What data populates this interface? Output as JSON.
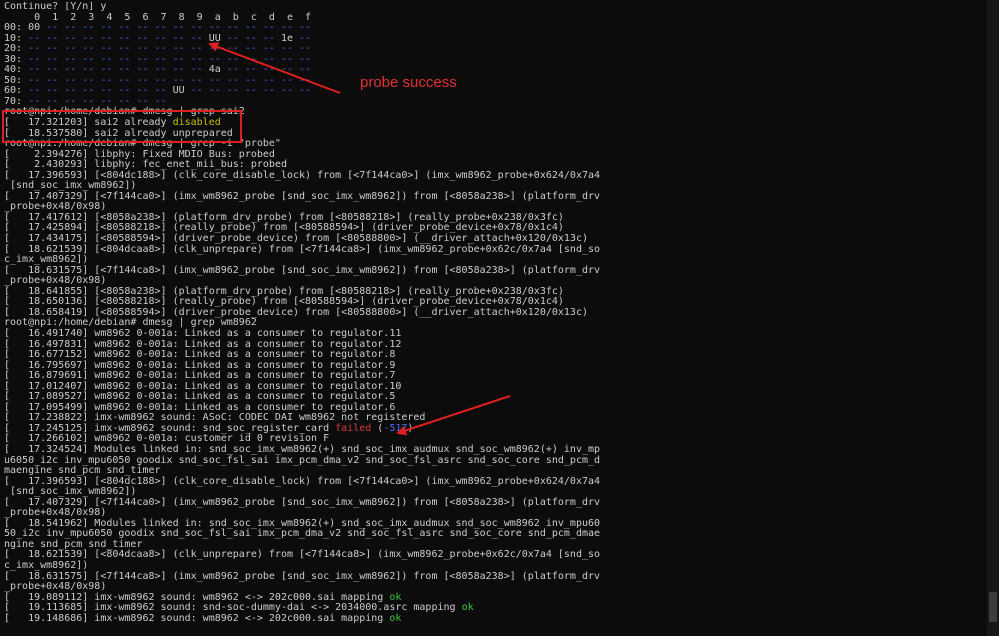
{
  "terminal": {
    "lines": [
      [
        {
          "t": "Continue? [Y/n] y",
          "c": "grey"
        }
      ],
      [
        {
          "t": "     0  1  2  3  4  5  6  7  8  9  a  b  c  d  e  f",
          "c": "grey"
        }
      ],
      [
        {
          "t": "00: 00 ",
          "c": "grey"
        },
        {
          "t": "-- -- -- -- -- -- -- -- -- -- -- -- -- -- --",
          "c": "blue"
        }
      ],
      [
        {
          "t": "10: ",
          "c": "grey"
        },
        {
          "t": "-- -- -- -- -- -- -- -- -- -- ",
          "c": "blue"
        },
        {
          "t": "UU",
          "c": "grey"
        },
        {
          "t": " -- -- -- ",
          "c": "blue"
        },
        {
          "t": "1e",
          "c": "grey"
        },
        {
          "t": " --",
          "c": "blue"
        }
      ],
      [
        {
          "t": "20: ",
          "c": "grey"
        },
        {
          "t": "-- -- -- -- -- -- -- -- -- -- -- -- -- -- -- --",
          "c": "blue"
        }
      ],
      [
        {
          "t": "30: ",
          "c": "grey"
        },
        {
          "t": "-- -- -- -- -- -- -- -- -- -- -- -- -- -- -- --",
          "c": "blue"
        }
      ],
      [
        {
          "t": "40: ",
          "c": "grey"
        },
        {
          "t": "-- -- -- -- -- -- -- -- -- -- ",
          "c": "blue"
        },
        {
          "t": "4a",
          "c": "grey"
        },
        {
          "t": " -- -- -- -- --",
          "c": "blue"
        }
      ],
      [
        {
          "t": "50: ",
          "c": "grey"
        },
        {
          "t": "-- -- -- -- -- -- -- -- -- -- -- -- -- -- -- --",
          "c": "blue"
        }
      ],
      [
        {
          "t": "60: ",
          "c": "grey"
        },
        {
          "t": "-- -- -- -- -- -- -- -- ",
          "c": "blue"
        },
        {
          "t": "UU",
          "c": "grey"
        },
        {
          "t": " -- -- -- -- -- -- --",
          "c": "blue"
        }
      ],
      [
        {
          "t": "70: ",
          "c": "grey"
        },
        {
          "t": "-- -- -- -- -- -- -- --",
          "c": "blue"
        }
      ],
      [
        {
          "t": "root@npi:/home/debian# dmesg | grep sai2",
          "c": "grey"
        }
      ],
      [
        {
          "t": "[   17.321203] sai2 already ",
          "c": "grey"
        },
        {
          "t": "disabled",
          "c": "yellow"
        }
      ],
      [
        {
          "t": "[   18.537580] sai2 already unprepared",
          "c": "grey"
        }
      ],
      [
        {
          "t": "root@npi:/home/debian# dmesg | grep -i \"probe\"",
          "c": "grey"
        }
      ],
      [
        {
          "t": "[    2.394276] libphy: Fixed MDIO Bus: probed",
          "c": "grey"
        }
      ],
      [
        {
          "t": "[    2.430293] libphy: fec_enet_mii_bus: probed",
          "c": "grey"
        }
      ],
      [
        {
          "t": "[   17.396593] [<804dc188>] (clk_core_disable_lock) from [<7f144ca0>] (imx_wm8962_probe+0x624/0x7a4",
          "c": "grey"
        }
      ],
      [
        {
          "t": " [snd_soc_imx_wm8962])",
          "c": "grey"
        }
      ],
      [
        {
          "t": "[   17.407329] [<7f144ca0>] (imx_wm8962_probe [snd_soc_imx_wm8962]) from [<8058a238>] (platform_drv",
          "c": "grey"
        }
      ],
      [
        {
          "t": "_probe+0x48/0x98)",
          "c": "grey"
        }
      ],
      [
        {
          "t": "[   17.417612] [<8058a238>] (platform_drv_probe) from [<80588218>] (really_probe+0x238/0x3fc)",
          "c": "grey"
        }
      ],
      [
        {
          "t": "[   17.425894] [<80588218>] (really_probe) from [<80588594>] (driver_probe_device+0x78/0x1c4)",
          "c": "grey"
        }
      ],
      [
        {
          "t": "[   17.434175] [<80588594>] (driver_probe_device) from [<80588800>] (__driver_attach+0x120/0x13c)",
          "c": "grey"
        }
      ],
      [
        {
          "t": "[   18.621539] [<804dcaa8>] (clk_unprepare) from [<7f144ca8>] (imx_wm8962_probe+0x62c/0x7a4 [snd_so",
          "c": "grey"
        }
      ],
      [
        {
          "t": "c_imx_wm8962])",
          "c": "grey"
        }
      ],
      [
        {
          "t": "[   18.631575] [<7f144ca8>] (imx_wm8962_probe [snd_soc_imx_wm8962]) from [<8058a238>] (platform_drv",
          "c": "grey"
        }
      ],
      [
        {
          "t": "_probe+0x48/0x98)",
          "c": "grey"
        }
      ],
      [
        {
          "t": "[   18.641855] [<8058a238>] (platform_drv_probe) from [<80588218>] (really_probe+0x238/0x3fc)",
          "c": "grey"
        }
      ],
      [
        {
          "t": "[   18.650136] [<80588218>] (really_probe) from [<80588594>] (driver_probe_device+0x78/0x1c4)",
          "c": "grey"
        }
      ],
      [
        {
          "t": "[   18.658419] [<80588594>] (driver_probe_device) from [<80588800>] (__driver_attach+0x120/0x13c)",
          "c": "grey"
        }
      ],
      [
        {
          "t": "root@npi:/home/debian# dmesg | grep wm8962",
          "c": "grey"
        }
      ],
      [
        {
          "t": "[   16.491740] wm8962 0-001a: Linked as a consumer to regulator.11",
          "c": "grey"
        }
      ],
      [
        {
          "t": "[   16.497831] wm8962 0-001a: Linked as a consumer to regulator.12",
          "c": "grey"
        }
      ],
      [
        {
          "t": "[   16.677152] wm8962 0-001a: Linked as a consumer to regulator.8",
          "c": "grey"
        }
      ],
      [
        {
          "t": "[   16.795697] wm8962 0-001a: Linked as a consumer to regulator.9",
          "c": "grey"
        }
      ],
      [
        {
          "t": "[   16.879691] wm8962 0-001a: Linked as a consumer to regulator.7",
          "c": "grey"
        }
      ],
      [
        {
          "t": "[   17.012407] wm8962 0-001a: Linked as a consumer to regulator.10",
          "c": "grey"
        }
      ],
      [
        {
          "t": "[   17.089527] wm8962 0-001a: Linked as a consumer to regulator.5",
          "c": "grey"
        }
      ],
      [
        {
          "t": "[   17.095499] wm8962 0-001a: Linked as a consumer to regulator.6",
          "c": "grey"
        }
      ],
      [
        {
          "t": "[   17.238822] imx-wm8962 sound: ASoC: CODEC DAI wm8962 not registered",
          "c": "grey"
        }
      ],
      [
        {
          "t": "[   17.245125] imx-wm8962 sound: snd_soc_register_card ",
          "c": "grey"
        },
        {
          "t": "failed",
          "c": "red"
        },
        {
          "t": " (",
          "c": "grey"
        },
        {
          "t": "-517",
          "c": "blue"
        },
        {
          "t": ")",
          "c": "grey"
        }
      ],
      [
        {
          "t": "[   17.266102] wm8962 0-001a: customer id 0 revision F",
          "c": "grey"
        }
      ],
      [
        {
          "t": "[   17.324524] Modules linked in: snd_soc_imx_wm8962(+) snd_soc_imx_audmux snd_soc_wm8962(+) inv_mp",
          "c": "grey"
        }
      ],
      [
        {
          "t": "u6050_i2c inv_mpu6050 goodix snd_soc_fsl_sai imx_pcm_dma_v2 snd_soc_fsl_asrc snd_soc_core snd_pcm_d",
          "c": "grey"
        }
      ],
      [
        {
          "t": "maengine snd_pcm snd_timer",
          "c": "grey"
        }
      ],
      [
        {
          "t": "[   17.396593] [<804dc188>] (clk_core_disable_lock) from [<7f144ca0>] (imx_wm8962_probe+0x624/0x7a4",
          "c": "grey"
        }
      ],
      [
        {
          "t": " [snd_soc_imx_wm8962])",
          "c": "grey"
        }
      ],
      [
        {
          "t": "[   17.407329] [<7f144ca0>] (imx_wm8962_probe [snd_soc_imx_wm8962]) from [<8058a238>] (platform_drv",
          "c": "grey"
        }
      ],
      [
        {
          "t": "_probe+0x48/0x98)",
          "c": "grey"
        }
      ],
      [
        {
          "t": "[   18.541962] Modules linked in: snd_soc_imx_wm8962(+) snd_soc_imx_audmux snd_soc_wm8962 inv_mpu60",
          "c": "grey"
        }
      ],
      [
        {
          "t": "50_i2c inv_mpu6050 goodix snd_soc_fsl_sai imx_pcm_dma_v2 snd_soc_fsl_asrc snd_soc_core snd_pcm_dmae",
          "c": "grey"
        }
      ],
      [
        {
          "t": "ngine snd_pcm snd_timer",
          "c": "grey"
        }
      ],
      [
        {
          "t": "[   18.621539] [<804dcaa8>] (clk_unprepare) from [<7f144ca8>] (imx_wm8962_probe+0x62c/0x7a4 [snd_so",
          "c": "grey"
        }
      ],
      [
        {
          "t": "c_imx_wm8962])",
          "c": "grey"
        }
      ],
      [
        {
          "t": "[   18.631575] [<7f144ca8>] (imx_wm8962_probe [snd_soc_imx_wm8962]) from [<8058a238>] (platform_drv",
          "c": "grey"
        }
      ],
      [
        {
          "t": "_probe+0x48/0x98)",
          "c": "grey"
        }
      ],
      [
        {
          "t": "[   19.089112] imx-wm8962 sound: wm8962 <-> 202c000.sai mapping ",
          "c": "grey"
        },
        {
          "t": "ok",
          "c": "green"
        }
      ],
      [
        {
          "t": "[   19.113685] imx-wm8962 sound: snd-soc-dummy-dai <-> 2034000.asrc mapping ",
          "c": "grey"
        },
        {
          "t": "ok",
          "c": "green"
        }
      ],
      [
        {
          "t": "[   19.148686] imx-wm8962 sound: wm8962 <-> 202c000.sai mapping ",
          "c": "grey"
        },
        {
          "t": "ok",
          "c": "green"
        }
      ]
    ]
  },
  "annotations": {
    "probe_label": "probe success"
  },
  "colors": {
    "background": "#0c0c0c",
    "text": "#cccccc",
    "annotation_red": "#e02020"
  }
}
